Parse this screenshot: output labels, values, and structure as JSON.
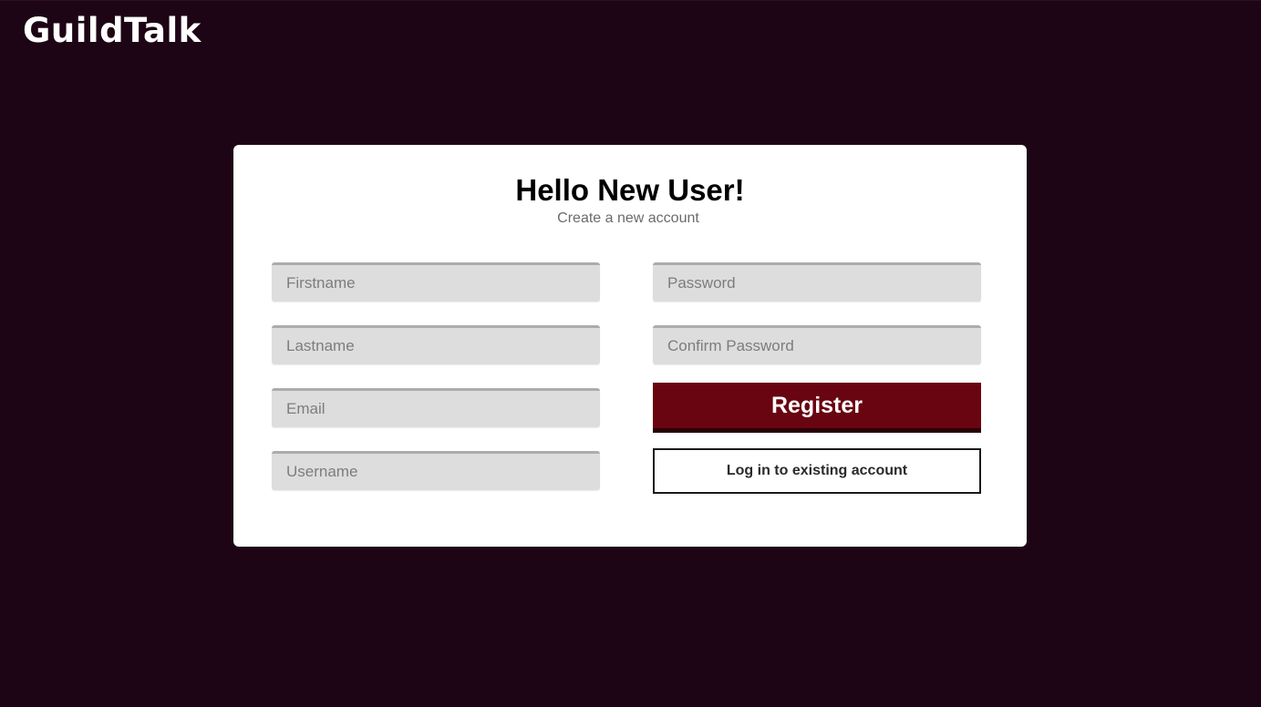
{
  "app": {
    "logo_text": "GuildTalk",
    "background_color": "#1d0515",
    "accent_color": "#680511"
  },
  "form": {
    "title": "Hello New User!",
    "subtitle": "Create a new account",
    "fields": {
      "firstname": {
        "placeholder": "Firstname",
        "value": ""
      },
      "lastname": {
        "placeholder": "Lastname",
        "value": ""
      },
      "email": {
        "placeholder": "Email",
        "value": ""
      },
      "username": {
        "placeholder": "Username",
        "value": ""
      },
      "password": {
        "placeholder": "Password",
        "value": ""
      },
      "confirm_password": {
        "placeholder": "Confirm Password",
        "value": ""
      }
    },
    "register_label": "Register",
    "login_label": "Log in to existing account"
  }
}
